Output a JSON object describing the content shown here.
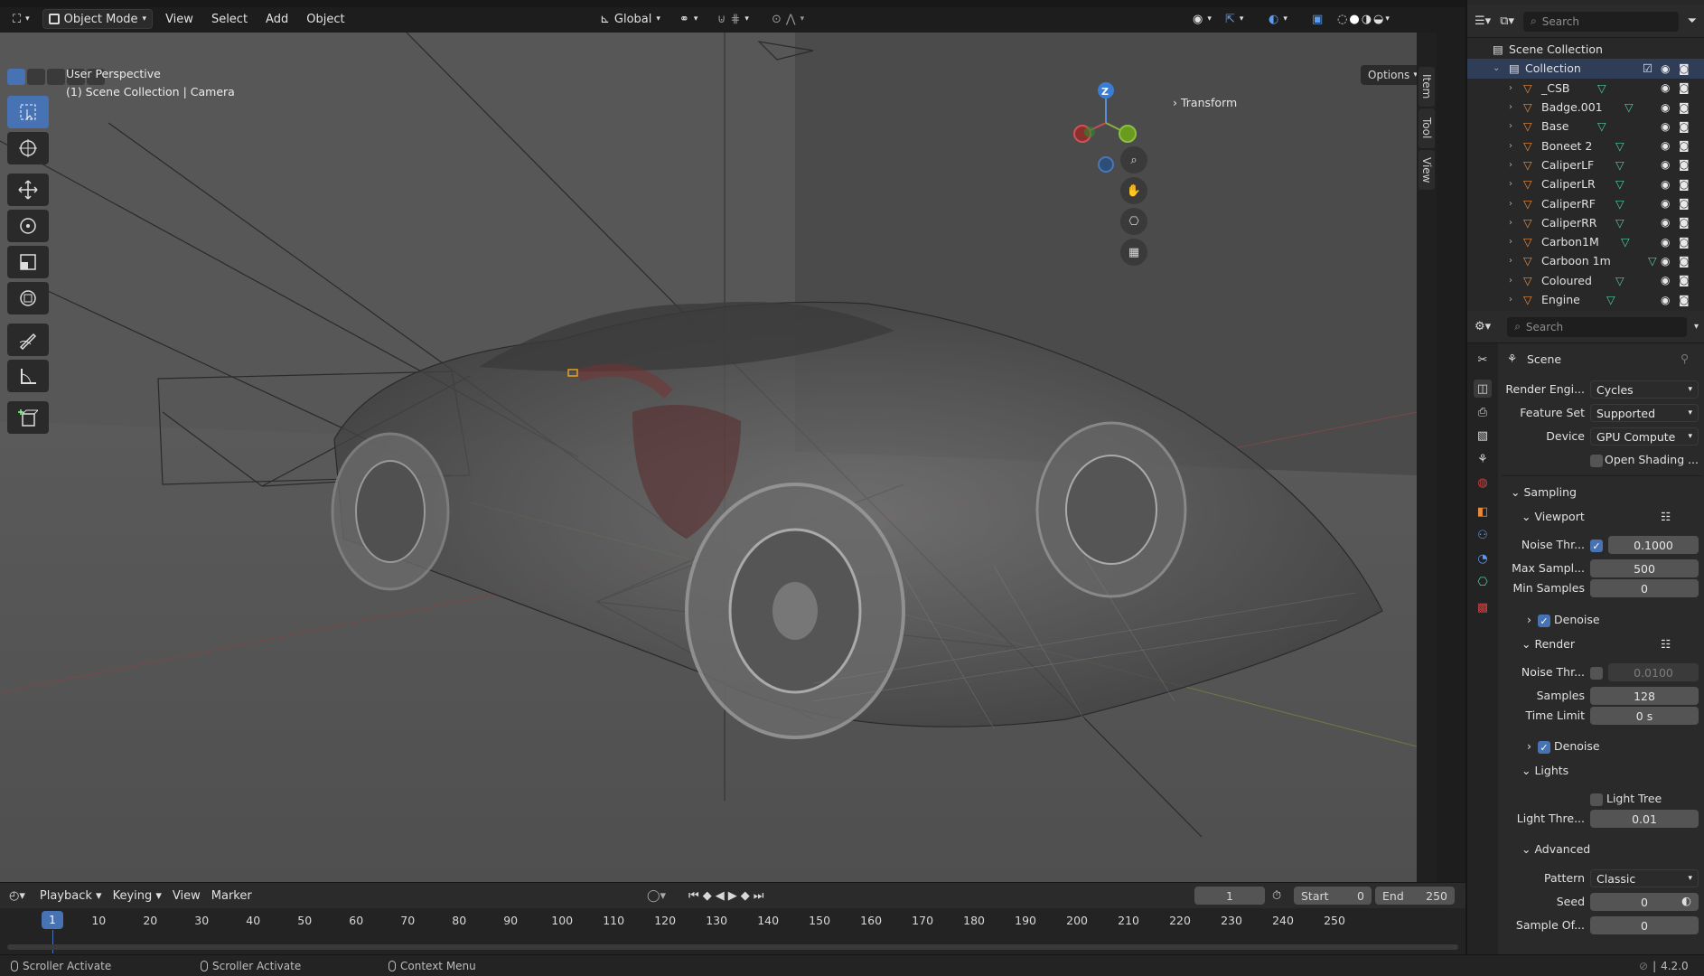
{
  "header": {
    "mode": "Object Mode",
    "menus": [
      "View",
      "Select",
      "Add",
      "Object"
    ],
    "transform_orientation": "Global"
  },
  "viewport": {
    "perspective_label": "User Perspective",
    "context_label": "(1) Scene Collection | Camera",
    "options_label": "Options",
    "transform_label": "Transform",
    "gizmo_z": "Z",
    "side_tabs": [
      "Item",
      "Tool",
      "View"
    ]
  },
  "outliner": {
    "search_placeholder": "Search",
    "scene_collection": "Scene Collection",
    "collection": "Collection",
    "objects": [
      "_CSB",
      "Badge.001",
      "Base",
      "Boneet 2",
      "CaliperLF",
      "CaliperLR",
      "CaliperRF",
      "CaliperRR",
      "Carbon1M",
      "Carboon 1m",
      "Coloured",
      "Engine"
    ]
  },
  "properties": {
    "search_placeholder": "Search",
    "context": "Scene",
    "render_engine_label": "Render Engi...",
    "render_engine": "Cycles",
    "feature_set_label": "Feature Set",
    "feature_set": "Supported",
    "device_label": "Device",
    "device": "GPU Compute",
    "open_shading": "Open Shading ...",
    "sampling": "Sampling",
    "viewport": "Viewport",
    "noise_thr_label": "Noise Thr...",
    "vp_noise_thr": "0.1000",
    "max_samples_label": "Max Sampl...",
    "vp_max_samples": "500",
    "min_samples_label": "Min Samples",
    "vp_min_samples": "0",
    "denoise": "Denoise",
    "render": "Render",
    "r_noise_thr": "0.0100",
    "samples_label": "Samples",
    "r_samples": "128",
    "time_limit_label": "Time Limit",
    "r_time_limit": "0 s",
    "lights": "Lights",
    "light_tree": "Light Tree",
    "light_thre_label": "Light Thre...",
    "light_threshold": "0.01",
    "advanced": "Advanced",
    "pattern_label": "Pattern",
    "pattern": "Classic",
    "seed_label": "Seed",
    "seed": "0",
    "sample_of_label": "Sample Of...",
    "sample_offset": "0"
  },
  "timeline": {
    "menus": [
      "Playback",
      "Keying",
      "View",
      "Marker"
    ],
    "current_frame": "1",
    "start_label": "Start",
    "start": "0",
    "end_label": "End",
    "end": "250",
    "ticks": [
      "1",
      "10",
      "20",
      "30",
      "40",
      "50",
      "60",
      "70",
      "80",
      "90",
      "100",
      "110",
      "120",
      "130",
      "140",
      "150",
      "160",
      "170",
      "180",
      "190",
      "200",
      "210",
      "220",
      "230",
      "240",
      "250"
    ]
  },
  "statusbar": {
    "item1": "Scroller Activate",
    "item2": "Scroller Activate",
    "item3": "Context Menu",
    "version": "4.2.0"
  },
  "colors": {
    "accent": "#4772b3",
    "object_orange": "#e88a3a",
    "mesh_green": "#4ec9a5"
  }
}
